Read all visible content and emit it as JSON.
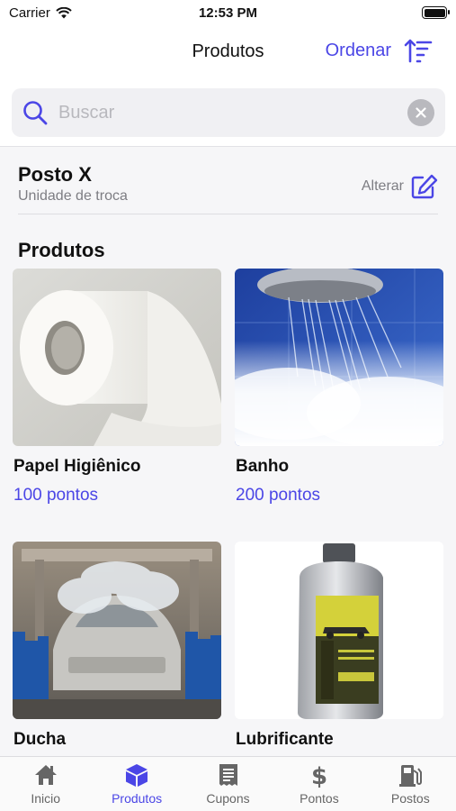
{
  "status_bar": {
    "carrier": "Carrier",
    "time": "12:53 PM"
  },
  "nav": {
    "title": "Produtos",
    "sort_label": "Ordenar"
  },
  "search": {
    "placeholder": "Buscar",
    "value": ""
  },
  "station": {
    "name": "Posto X",
    "subtitle": "Unidade de troca",
    "change_label": "Alterar"
  },
  "products_section": {
    "title": "Produtos"
  },
  "products": [
    {
      "name": "Papel Higiênico",
      "points": "100 pontos",
      "image": "toilet-paper"
    },
    {
      "name": "Banho",
      "points": "200 pontos",
      "image": "shower"
    },
    {
      "name": "Ducha",
      "points": "",
      "image": "car-wash"
    },
    {
      "name": "Lubrificante",
      "points": "",
      "image": "motor-oil"
    }
  ],
  "tabs": [
    {
      "label": "Inicio",
      "icon": "home-icon"
    },
    {
      "label": "Produtos",
      "icon": "box-icon",
      "active": true
    },
    {
      "label": "Cupons",
      "icon": "receipt-icon"
    },
    {
      "label": "Pontos",
      "icon": "dollar-icon"
    },
    {
      "label": "Postos",
      "icon": "fuel-pump-icon"
    }
  ],
  "colors": {
    "accent": "#4b46e6",
    "muted": "#7d7d83",
    "background": "#f6f6f8"
  }
}
